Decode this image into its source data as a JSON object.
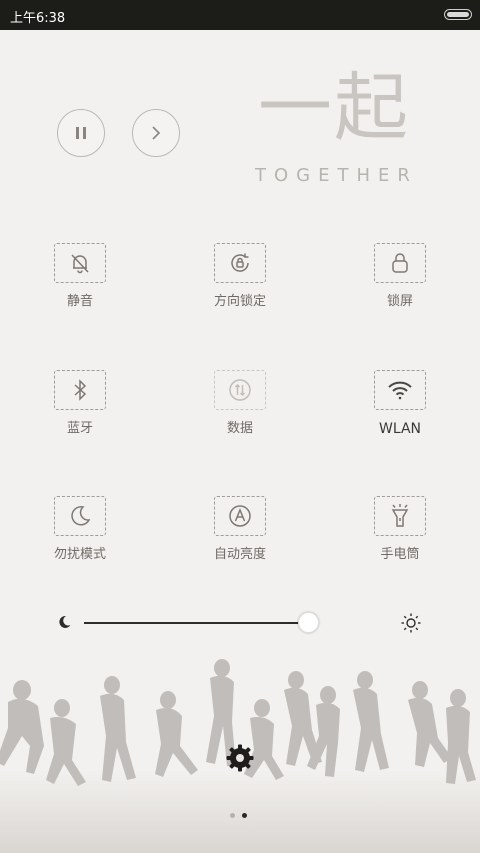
{
  "status": {
    "time": "上午6:38"
  },
  "header": {
    "title_cn": "一起",
    "title_en": "TOGETHER"
  },
  "media": {
    "pause_icon": "pause-icon",
    "next_icon": "chevron-right-icon"
  },
  "toggles": [
    {
      "label": "静音",
      "icon": "bell-off-icon",
      "state": "off"
    },
    {
      "label": "方向锁定",
      "icon": "rotation-lock-icon",
      "state": "off"
    },
    {
      "label": "锁屏",
      "icon": "lock-icon",
      "state": "off"
    },
    {
      "label": "蓝牙",
      "icon": "bluetooth-icon",
      "state": "off"
    },
    {
      "label": "数据",
      "icon": "data-icon",
      "state": "disabled"
    },
    {
      "label": "WLAN",
      "icon": "wifi-icon",
      "state": "on"
    },
    {
      "label": "勿扰模式",
      "icon": "moon-icon",
      "state": "off"
    },
    {
      "label": "自动亮度",
      "icon": "auto-brightness-icon",
      "state": "off"
    },
    {
      "label": "手电筒",
      "icon": "flashlight-icon",
      "state": "off"
    }
  ],
  "brightness": {
    "level": 1.0,
    "min_icon": "moon-icon",
    "max_icon": "sun-icon"
  },
  "pager": {
    "pages": 2,
    "current": 2
  },
  "colors": {
    "status_bar": "#1c1c18",
    "background": "#f3f1ef",
    "icon": "#7e7873",
    "label": "#6f6a66",
    "track": "#2f2c29"
  }
}
